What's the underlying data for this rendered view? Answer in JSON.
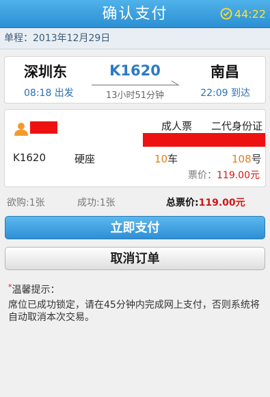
{
  "header": {
    "title": "确认支付",
    "timer": "44:22"
  },
  "trip": {
    "date_label": "单程：2013年12月29日",
    "from_station": "深圳东",
    "to_station": "南昌",
    "train_no": "K1620",
    "depart_time": "08:18 出发",
    "arrive_time": "22:09 到达",
    "duration": "13小时51分钟"
  },
  "passenger": {
    "ticket_type": "成人票",
    "id_type": "二代身份证",
    "train_no": "K1620",
    "seat_class": "硬座",
    "car_num": "10",
    "car_unit": "车",
    "seat_num": "108",
    "seat_unit": "号",
    "price_label": "票价：",
    "price_value": "119.00元"
  },
  "summary": {
    "want": "欲购:1张",
    "success": "成功:1张",
    "total_label": "总票价:",
    "total_value": "119.00元"
  },
  "actions": {
    "pay": "立即支付",
    "cancel": "取消订单"
  },
  "tips": {
    "title": "温馨提示：",
    "body": "席位已成功锁定，请在45分钟内完成网上支付，否则系统将自动取消本次交易。"
  },
  "colors": {
    "header": "#2c8fd3",
    "timer": "#ffe22a",
    "accent_blue": "#2a7ac4",
    "price_red": "#d41515",
    "seat_orange": "#e07f1e",
    "redaction": "#ee1111"
  },
  "icons": {
    "timer": "clock-icon",
    "passenger": "person-icon",
    "direction": "arrow-right-icon"
  }
}
